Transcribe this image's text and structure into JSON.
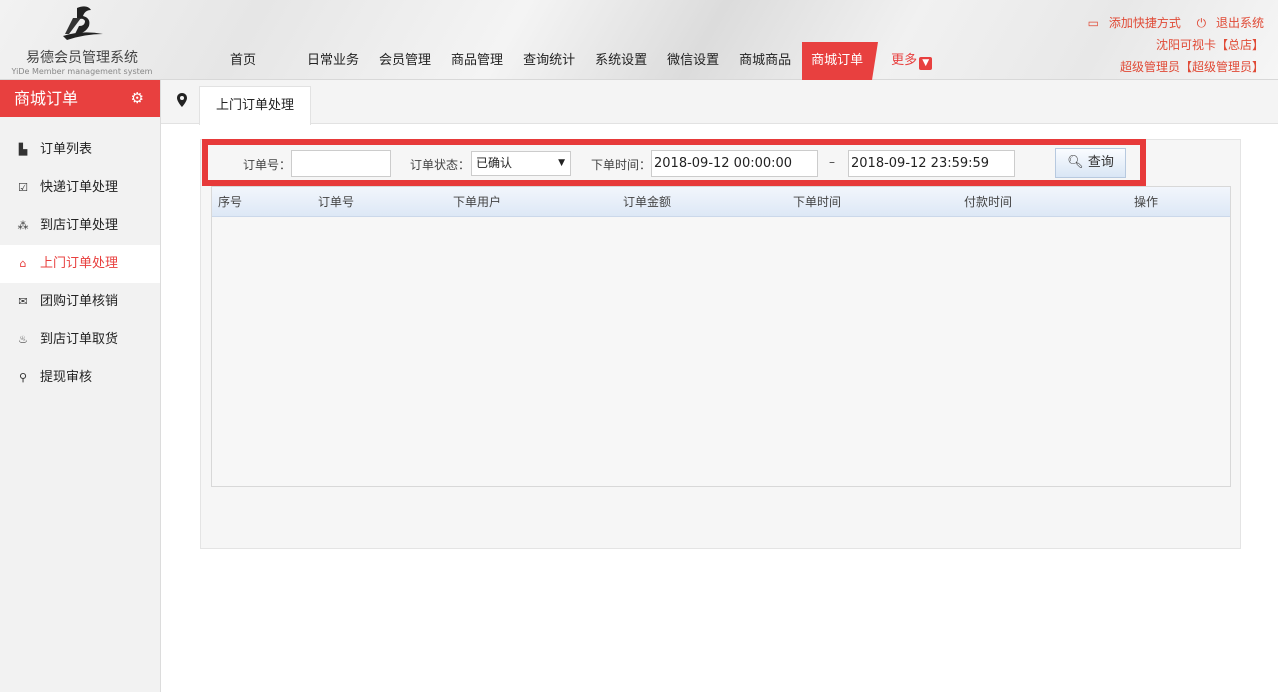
{
  "logo": {
    "title": "易德会员管理系统",
    "subtitle": "YiDe Member management system"
  },
  "nav": {
    "items": [
      "首页",
      "日常业务",
      "会员管理",
      "商品管理",
      "查询统计",
      "系统设置",
      "微信设置",
      "商城商品",
      "商城订单"
    ],
    "active": "商城订单",
    "more": "更多"
  },
  "top_right": {
    "add_shortcut": "添加快捷方式",
    "logout": "退出系统",
    "store": "沈阳可视卡【总店】",
    "user": "超级管理员【超级管理员】"
  },
  "sidebar": {
    "title": "商城订单",
    "items": [
      {
        "label": "订单列表",
        "icon": "bar-chart-icon"
      },
      {
        "label": "快递订单处理",
        "icon": "checkbox-icon"
      },
      {
        "label": "到店订单处理",
        "icon": "cubes-icon"
      },
      {
        "label": "上门订单处理",
        "icon": "home-icon",
        "active": true
      },
      {
        "label": "团购订单核销",
        "icon": "envelope-icon"
      },
      {
        "label": "到店订单取货",
        "icon": "basket-icon"
      },
      {
        "label": "提现审核",
        "icon": "search-icon"
      }
    ]
  },
  "tab": {
    "label": "上门订单处理"
  },
  "filter": {
    "order_no_label": "订单号：",
    "order_no_value": "",
    "status_label": "订单状态：",
    "status_value": "已确认",
    "time_label": "下单时间：",
    "time_start": "2018-09-12 00:00:00",
    "separator": "–",
    "time_end": "2018-09-12 23:59:59",
    "search_button": "查询"
  },
  "table": {
    "columns": [
      "序号",
      "订单号",
      "下单用户",
      "订单金额",
      "下单时间",
      "付款时间",
      "操作"
    ],
    "rows": []
  },
  "colors": {
    "accent": "#e8403f",
    "highlight_border": "#e73a3a"
  }
}
